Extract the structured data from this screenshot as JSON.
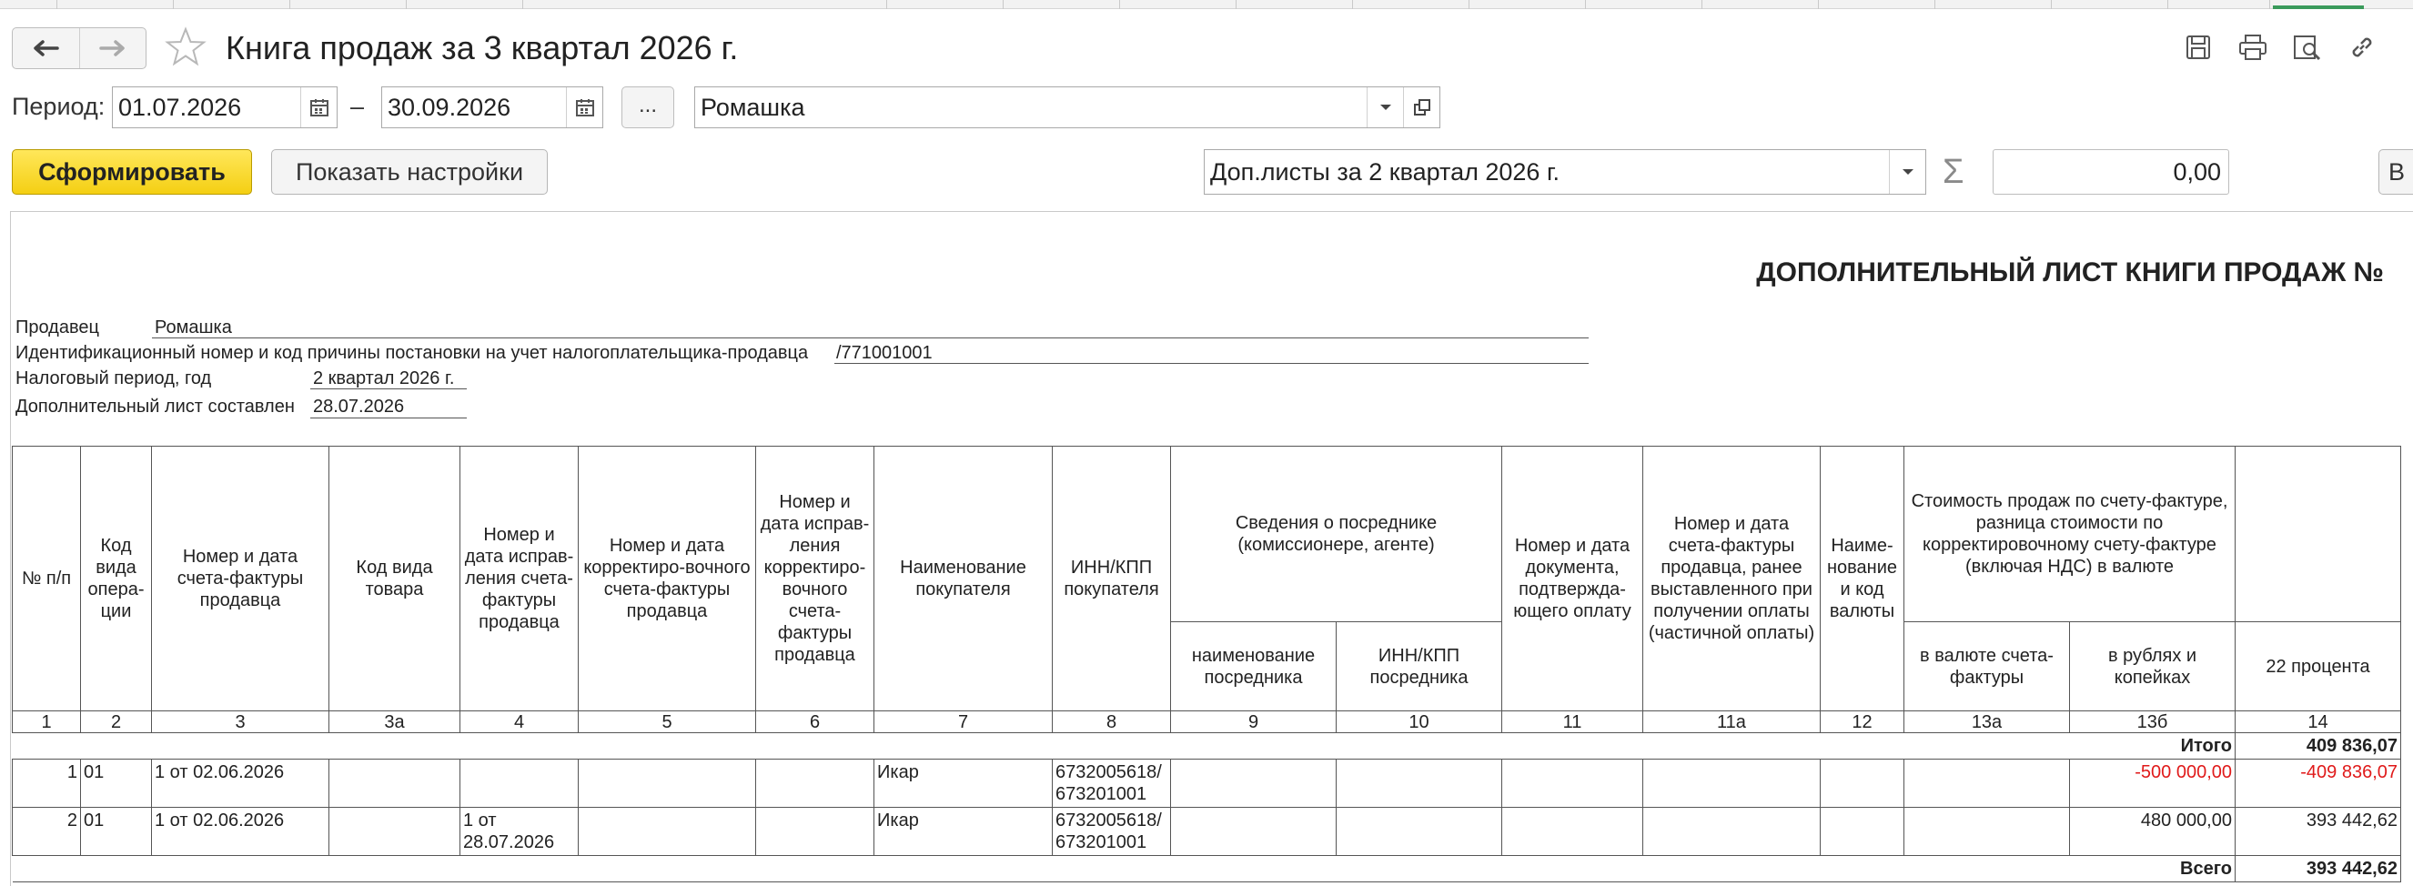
{
  "window": {
    "title": "Книга продаж за 3 квартал 2026 г."
  },
  "nav": {
    "back_icon": "arrow-left-icon",
    "forward_icon": "arrow-right-icon",
    "favorite_icon": "star-icon"
  },
  "toolbar_icons": [
    "save-icon",
    "print-icon",
    "preview-icon",
    "link-icon"
  ],
  "filters": {
    "period_label": "Период:",
    "date_from": "01.07.2026",
    "dash": "–",
    "date_to": "30.09.2026",
    "dots_label": "...",
    "organization": "Ромашка",
    "addsheet_select": "Доп.листы за 2 квартал 2026 г.",
    "sum_value": "0,00",
    "cut_button_label": "В"
  },
  "buttons": {
    "generate": "Сформировать",
    "show_settings": "Показать настройки"
  },
  "report": {
    "title": "ДОПОЛНИТЕЛЬНЫЙ ЛИСТ КНИГИ ПРОДАЖ №",
    "seller_label": "Продавец",
    "seller_value": "Ромашка",
    "inn_label": "Идентификационный номер и код причины постановки на учет налогоплательщика-продавца",
    "inn_value": "/771001001",
    "period_label": "Налоговый период, год",
    "period_value": "2 квартал 2026 г.",
    "compiled_label": "Дополнительный лист составлен",
    "compiled_value": "28.07.2026"
  },
  "table": {
    "headers": {
      "c1": "№ п/п",
      "c2": "Код вида опера-ции",
      "c3": "Номер и дата счета-фактуры продавца",
      "c3a": "Код вида товара",
      "c4": "Номер и дата исправ-ления счета-фактуры продавца",
      "c5": "Номер и дата корректиро-вочного счета-фактуры продавца",
      "c6": "Номер и дата исправ-ления корректиро-вочного счета-фактуры продавца",
      "c7": "Наименование покупателя",
      "c8": "ИНН/КПП покупателя",
      "c9_10_group": "Сведения о посреднике (комиссионере, агенте)",
      "c9": "наименование посредника",
      "c10": "ИНН/КПП посредника",
      "c11": "Номер и дата документа, подтвержда-ющего оплату",
      "c11a": "Номер и дата счета-фактуры продавца, ранее выставленного при получении оплаты (частичной оплаты)",
      "c12": "Наиме-нование и код валюты",
      "c13_group": "Стоимость продаж по счету-фактуре, разница стоимости по корректировочному счету-фактуре (включая НДС) в валюте",
      "c13a": "в валюте счета-фактуры",
      "c13b": "в рублях и копейках",
      "c14": "22 процента"
    },
    "column_numbers": [
      "1",
      "2",
      "3",
      "3а",
      "4",
      "5",
      "6",
      "7",
      "8",
      "9",
      "10",
      "11",
      "11а",
      "12",
      "13а",
      "13б",
      "14"
    ],
    "total_label": "Итого",
    "total_value": "409 836,07",
    "rows": [
      {
        "n": "1",
        "op": "01",
        "invoice": "1 от 02.06.2026",
        "fix": "",
        "buyer": "Икар",
        "inn1": "6732005618/",
        "inn2": "673201001",
        "rub": "-500 000,00",
        "vat22": "-409 836,07"
      },
      {
        "n": "2",
        "op": "01",
        "invoice": "1 от 02.06.2026",
        "fix1": "1 от",
        "fix2": "28.07.2026",
        "buyer": "Икар",
        "inn1": "6732005618/",
        "inn2": "673201001",
        "rub": "480 000,00",
        "vat22": "393 442,62"
      }
    ],
    "grand_label": "Всего",
    "grand_value": "393 442,62"
  }
}
